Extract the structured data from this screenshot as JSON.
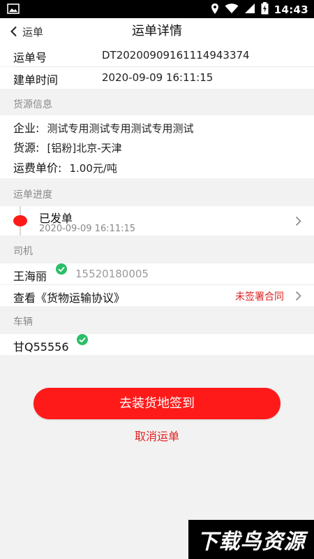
{
  "status_bar": {
    "time": "14:43"
  },
  "nav": {
    "back_label": "运单",
    "title": "运单详情"
  },
  "order": {
    "number_label": "运单号",
    "number_value": "DT20200909161114943374",
    "created_label": "建单时间",
    "created_value": "2020-09-09 16:11:15"
  },
  "cargo": {
    "section_title": "货源信息",
    "company_label": "企业:",
    "company_value": "测试专用测试专用测试专用测试",
    "source_label": "货源:",
    "source_value": "[铝粉]北京-天津",
    "price_label": "运费单价:",
    "price_value": "1.00元/吨"
  },
  "progress": {
    "section_title": "运单进度",
    "status": "已发单",
    "time": "2020-09-09 16:11:15"
  },
  "driver": {
    "section_title": "司机",
    "name": "王海丽",
    "phone": "15520180005",
    "agreement_label": "查看《货物运输协议》",
    "agreement_status": "未签署合同"
  },
  "vehicle": {
    "section_title": "车辆",
    "plate": "甘Q55556"
  },
  "actions": {
    "primary": "去装货地签到",
    "secondary": "取消运单"
  },
  "watermark": {
    "text": "下载鸟资源"
  },
  "colors": {
    "accent": "#ff1a1a",
    "link_red": "#e02020",
    "verified_green": "#2cbe68"
  }
}
